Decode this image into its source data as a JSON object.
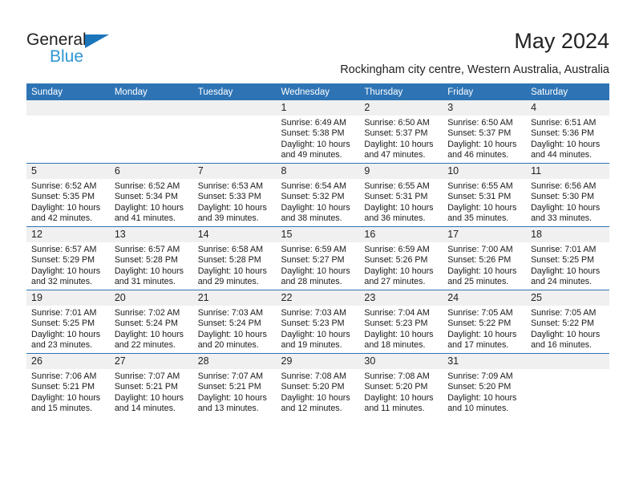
{
  "brand": {
    "name_part1": "General",
    "name_part2": "Blue",
    "color_dark": "#231f20",
    "color_blue": "#2e95d3",
    "triangle_color": "#1b75bb"
  },
  "header": {
    "title": "May 2024",
    "subtitle": "Rockingham city centre, Western Australia, Australia",
    "accent_color": "#2e74b5"
  },
  "calendar": {
    "weekday_headers": [
      "Sunday",
      "Monday",
      "Tuesday",
      "Wednesday",
      "Thursday",
      "Friday",
      "Saturday"
    ],
    "weeks": [
      [
        {
          "day": "",
          "empty": true
        },
        {
          "day": "",
          "empty": true
        },
        {
          "day": "",
          "empty": true
        },
        {
          "day": "1",
          "sunrise": "Sunrise: 6:49 AM",
          "sunset": "Sunset: 5:38 PM",
          "daylight1": "Daylight: 10 hours",
          "daylight2": "and 49 minutes."
        },
        {
          "day": "2",
          "sunrise": "Sunrise: 6:50 AM",
          "sunset": "Sunset: 5:37 PM",
          "daylight1": "Daylight: 10 hours",
          "daylight2": "and 47 minutes."
        },
        {
          "day": "3",
          "sunrise": "Sunrise: 6:50 AM",
          "sunset": "Sunset: 5:37 PM",
          "daylight1": "Daylight: 10 hours",
          "daylight2": "and 46 minutes."
        },
        {
          "day": "4",
          "sunrise": "Sunrise: 6:51 AM",
          "sunset": "Sunset: 5:36 PM",
          "daylight1": "Daylight: 10 hours",
          "daylight2": "and 44 minutes."
        }
      ],
      [
        {
          "day": "5",
          "sunrise": "Sunrise: 6:52 AM",
          "sunset": "Sunset: 5:35 PM",
          "daylight1": "Daylight: 10 hours",
          "daylight2": "and 42 minutes."
        },
        {
          "day": "6",
          "sunrise": "Sunrise: 6:52 AM",
          "sunset": "Sunset: 5:34 PM",
          "daylight1": "Daylight: 10 hours",
          "daylight2": "and 41 minutes."
        },
        {
          "day": "7",
          "sunrise": "Sunrise: 6:53 AM",
          "sunset": "Sunset: 5:33 PM",
          "daylight1": "Daylight: 10 hours",
          "daylight2": "and 39 minutes."
        },
        {
          "day": "8",
          "sunrise": "Sunrise: 6:54 AM",
          "sunset": "Sunset: 5:32 PM",
          "daylight1": "Daylight: 10 hours",
          "daylight2": "and 38 minutes."
        },
        {
          "day": "9",
          "sunrise": "Sunrise: 6:55 AM",
          "sunset": "Sunset: 5:31 PM",
          "daylight1": "Daylight: 10 hours",
          "daylight2": "and 36 minutes."
        },
        {
          "day": "10",
          "sunrise": "Sunrise: 6:55 AM",
          "sunset": "Sunset: 5:31 PM",
          "daylight1": "Daylight: 10 hours",
          "daylight2": "and 35 minutes."
        },
        {
          "day": "11",
          "sunrise": "Sunrise: 6:56 AM",
          "sunset": "Sunset: 5:30 PM",
          "daylight1": "Daylight: 10 hours",
          "daylight2": "and 33 minutes."
        }
      ],
      [
        {
          "day": "12",
          "sunrise": "Sunrise: 6:57 AM",
          "sunset": "Sunset: 5:29 PM",
          "daylight1": "Daylight: 10 hours",
          "daylight2": "and 32 minutes."
        },
        {
          "day": "13",
          "sunrise": "Sunrise: 6:57 AM",
          "sunset": "Sunset: 5:28 PM",
          "daylight1": "Daylight: 10 hours",
          "daylight2": "and 31 minutes."
        },
        {
          "day": "14",
          "sunrise": "Sunrise: 6:58 AM",
          "sunset": "Sunset: 5:28 PM",
          "daylight1": "Daylight: 10 hours",
          "daylight2": "and 29 minutes."
        },
        {
          "day": "15",
          "sunrise": "Sunrise: 6:59 AM",
          "sunset": "Sunset: 5:27 PM",
          "daylight1": "Daylight: 10 hours",
          "daylight2": "and 28 minutes."
        },
        {
          "day": "16",
          "sunrise": "Sunrise: 6:59 AM",
          "sunset": "Sunset: 5:26 PM",
          "daylight1": "Daylight: 10 hours",
          "daylight2": "and 27 minutes."
        },
        {
          "day": "17",
          "sunrise": "Sunrise: 7:00 AM",
          "sunset": "Sunset: 5:26 PM",
          "daylight1": "Daylight: 10 hours",
          "daylight2": "and 25 minutes."
        },
        {
          "day": "18",
          "sunrise": "Sunrise: 7:01 AM",
          "sunset": "Sunset: 5:25 PM",
          "daylight1": "Daylight: 10 hours",
          "daylight2": "and 24 minutes."
        }
      ],
      [
        {
          "day": "19",
          "sunrise": "Sunrise: 7:01 AM",
          "sunset": "Sunset: 5:25 PM",
          "daylight1": "Daylight: 10 hours",
          "daylight2": "and 23 minutes."
        },
        {
          "day": "20",
          "sunrise": "Sunrise: 7:02 AM",
          "sunset": "Sunset: 5:24 PM",
          "daylight1": "Daylight: 10 hours",
          "daylight2": "and 22 minutes."
        },
        {
          "day": "21",
          "sunrise": "Sunrise: 7:03 AM",
          "sunset": "Sunset: 5:24 PM",
          "daylight1": "Daylight: 10 hours",
          "daylight2": "and 20 minutes."
        },
        {
          "day": "22",
          "sunrise": "Sunrise: 7:03 AM",
          "sunset": "Sunset: 5:23 PM",
          "daylight1": "Daylight: 10 hours",
          "daylight2": "and 19 minutes."
        },
        {
          "day": "23",
          "sunrise": "Sunrise: 7:04 AM",
          "sunset": "Sunset: 5:23 PM",
          "daylight1": "Daylight: 10 hours",
          "daylight2": "and 18 minutes."
        },
        {
          "day": "24",
          "sunrise": "Sunrise: 7:05 AM",
          "sunset": "Sunset: 5:22 PM",
          "daylight1": "Daylight: 10 hours",
          "daylight2": "and 17 minutes."
        },
        {
          "day": "25",
          "sunrise": "Sunrise: 7:05 AM",
          "sunset": "Sunset: 5:22 PM",
          "daylight1": "Daylight: 10 hours",
          "daylight2": "and 16 minutes."
        }
      ],
      [
        {
          "day": "26",
          "sunrise": "Sunrise: 7:06 AM",
          "sunset": "Sunset: 5:21 PM",
          "daylight1": "Daylight: 10 hours",
          "daylight2": "and 15 minutes."
        },
        {
          "day": "27",
          "sunrise": "Sunrise: 7:07 AM",
          "sunset": "Sunset: 5:21 PM",
          "daylight1": "Daylight: 10 hours",
          "daylight2": "and 14 minutes."
        },
        {
          "day": "28",
          "sunrise": "Sunrise: 7:07 AM",
          "sunset": "Sunset: 5:21 PM",
          "daylight1": "Daylight: 10 hours",
          "daylight2": "and 13 minutes."
        },
        {
          "day": "29",
          "sunrise": "Sunrise: 7:08 AM",
          "sunset": "Sunset: 5:20 PM",
          "daylight1": "Daylight: 10 hours",
          "daylight2": "and 12 minutes."
        },
        {
          "day": "30",
          "sunrise": "Sunrise: 7:08 AM",
          "sunset": "Sunset: 5:20 PM",
          "daylight1": "Daylight: 10 hours",
          "daylight2": "and 11 minutes."
        },
        {
          "day": "31",
          "sunrise": "Sunrise: 7:09 AM",
          "sunset": "Sunset: 5:20 PM",
          "daylight1": "Daylight: 10 hours",
          "daylight2": "and 10 minutes."
        },
        {
          "day": "",
          "empty": true
        }
      ]
    ]
  }
}
